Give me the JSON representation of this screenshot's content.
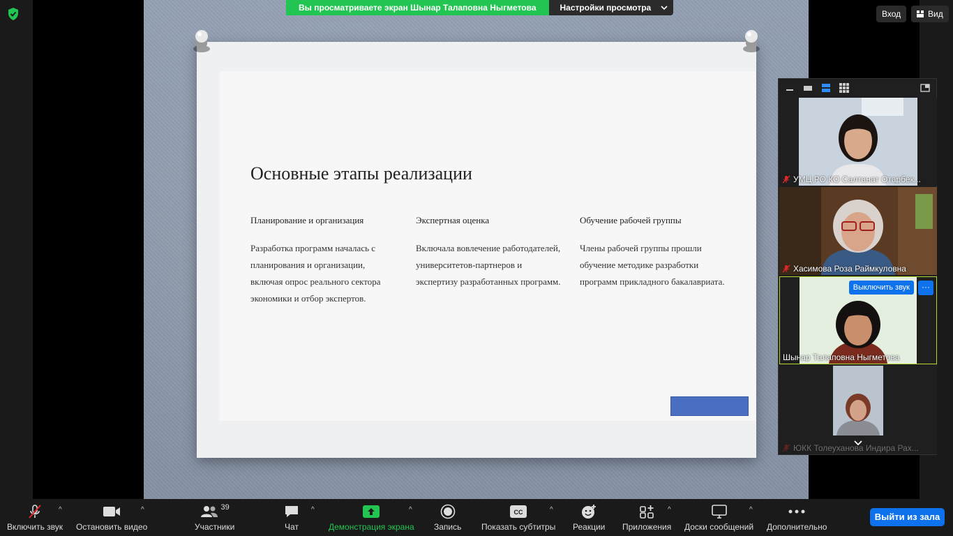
{
  "banner": {
    "viewing_text": "Вы просматриваете экран Шынар Талаповна Ныгметова",
    "view_options_label": "Настройки просмотра"
  },
  "top_right": {
    "signin_label": "Вход",
    "view_label": "Вид"
  },
  "slide": {
    "title": "Основные этапы реализации",
    "columns": [
      {
        "heading": "Планирование и организация",
        "text": "Разработка программ началась с планирования и организации, включая опрос реального сектора экономики и отбор экспертов."
      },
      {
        "heading": "Экспертная оценка",
        "text": "Включала вовлечение работодателей, университетов-партнеров и экспертизу разработанных программ."
      },
      {
        "heading": "Обучение рабочей группы",
        "text": "Члены рабочей группы прошли обучение методике разработки программ прикладного бакалавриата."
      }
    ]
  },
  "participants_panel": {
    "tiles": [
      {
        "name": "УМЦ РО КО Салтанат Отарбек...",
        "muted": true
      },
      {
        "name": "Хасимова Роза Раймкуловна",
        "muted": true
      },
      {
        "name": "Шынар Талаповна Ныгметова",
        "muted": false,
        "unmute_label": "Выключить звук",
        "more_label": "···"
      },
      {
        "name": "ЮКК Толеуханова Индира Рах...",
        "muted": true
      }
    ]
  },
  "toolbar": {
    "unmute": "Включить звук",
    "stop_video": "Остановить видео",
    "participants": "Участники",
    "participants_count": "39",
    "chat": "Чат",
    "share_screen": "Демонстрация экрана",
    "record": "Запись",
    "captions": "Показать субтитры",
    "reactions": "Реакции",
    "apps": "Приложения",
    "whiteboards": "Доски сообщений",
    "more": "Дополнительно",
    "leave": "Выйти из зала"
  },
  "colors": {
    "accent_blue": "#0e72ed",
    "share_green": "#23c552",
    "muted_red": "#e02828"
  }
}
